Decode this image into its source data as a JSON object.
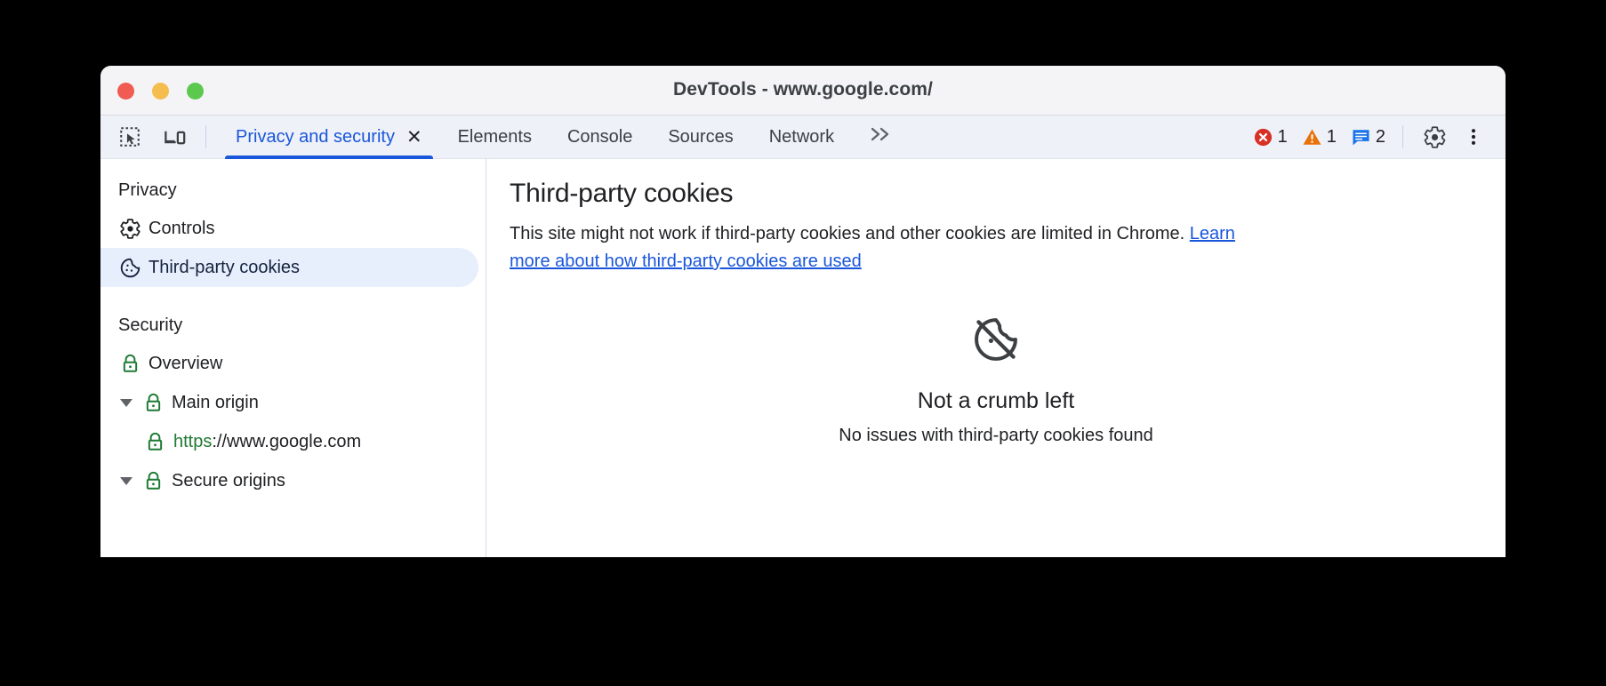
{
  "window": {
    "title": "DevTools - www.google.com/",
    "traffic_lights": [
      {
        "name": "close",
        "color": "#f05b52"
      },
      {
        "name": "minimize",
        "color": "#f4bd4e"
      },
      {
        "name": "maximize",
        "color": "#5cc94e"
      }
    ]
  },
  "toolbar": {
    "inspect_icon": "inspect-element-icon",
    "device_icon": "device-toolbar-icon",
    "more_tabs_label": "»",
    "settings_icon": "gear-icon",
    "more_options_icon": "kebab-menu-icon",
    "counters": [
      {
        "name": "errors",
        "icon": "error-icon",
        "count": "1",
        "color": "#d93025"
      },
      {
        "name": "warnings",
        "icon": "warning-icon",
        "count": "1",
        "color": "#e8710a"
      },
      {
        "name": "info",
        "icon": "message-icon",
        "count": "2",
        "color": "#1a73e8"
      }
    ]
  },
  "tabs": [
    {
      "label": "Privacy and security",
      "active": true,
      "closable": true,
      "close_glyph": "✕"
    },
    {
      "label": "Elements",
      "active": false
    },
    {
      "label": "Console",
      "active": false
    },
    {
      "label": "Sources",
      "active": false
    },
    {
      "label": "Network",
      "active": false
    }
  ],
  "sidebar": {
    "groups": [
      {
        "title": "Privacy",
        "items": [
          {
            "label": "Controls",
            "icon": "gear-icon",
            "selected": false,
            "indent": 0,
            "twisty": false
          },
          {
            "label": "Third-party cookies",
            "icon": "cookie-icon",
            "selected": true,
            "indent": 0,
            "twisty": false
          }
        ]
      },
      {
        "title": "Security",
        "items": [
          {
            "label": "Overview",
            "icon": "lock-icon",
            "selected": false,
            "indent": 0,
            "twisty": false
          },
          {
            "label": "Main origin",
            "icon": "lock-icon",
            "selected": false,
            "indent": 0,
            "twisty": true
          },
          {
            "label": "https://www.google.com",
            "label_scheme": "https",
            "label_rest": "://www.google.com",
            "icon": "lock-icon",
            "selected": false,
            "indent": 1,
            "twisty": false
          },
          {
            "label": "Secure origins",
            "icon": "lock-icon",
            "selected": false,
            "indent": 0,
            "twisty": true
          }
        ]
      }
    ]
  },
  "main": {
    "heading": "Third-party cookies",
    "description_prefix": "This site might not work if third-party cookies and other cookies are limited in Chrome. ",
    "learn_more_link": "Learn more about how third-party cookies are used",
    "empty_state": {
      "icon": "cookie-off-icon",
      "title": "Not a crumb left",
      "subtitle": "No issues with third-party cookies found"
    }
  },
  "colors": {
    "accent": "#1a56db",
    "selected_bg": "#e7eefc",
    "lock_green": "#1e7a33",
    "error_red": "#d93025",
    "warning_orange": "#e8710a",
    "info_blue": "#1a73e8"
  }
}
